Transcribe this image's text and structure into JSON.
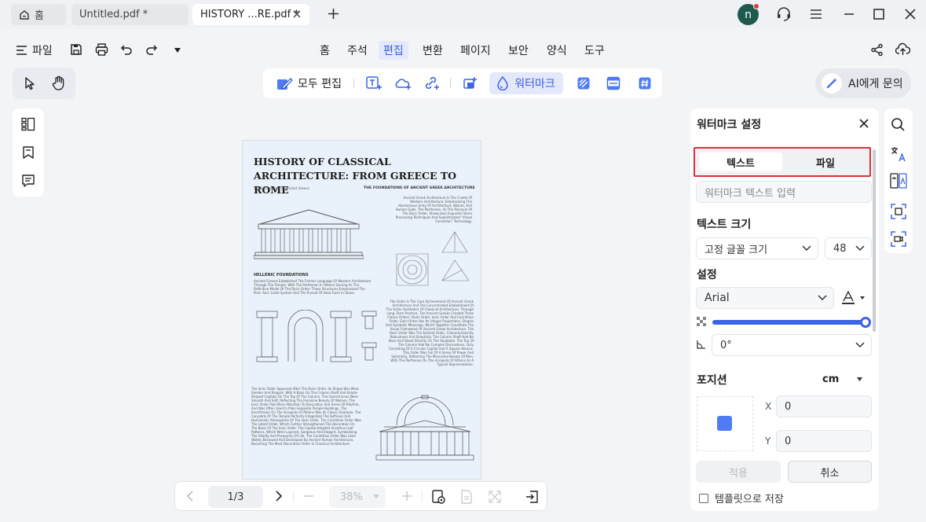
{
  "titlebar": {
    "home_label": "홈",
    "tabs": [
      {
        "label": "Untitled.pdf *"
      },
      {
        "label": "HISTORY ...RE.pdf *"
      }
    ],
    "avatar_letter": "n"
  },
  "menubar": {
    "file_label": "파일",
    "items": [
      {
        "label": "홈"
      },
      {
        "label": "주석"
      },
      {
        "label": "편집"
      },
      {
        "label": "변환"
      },
      {
        "label": "페이지"
      },
      {
        "label": "보안"
      },
      {
        "label": "양식"
      },
      {
        "label": "도구"
      }
    ],
    "active": "편집"
  },
  "edit_toolbar": {
    "edit_all_label": "모두 편집",
    "watermark_label": "워터마크"
  },
  "ai_button": {
    "label": "AI에게 문의"
  },
  "document": {
    "title": "HISTORY OF CLASSICAL  ARCHITECTURE: FROM GREECE TO ROME",
    "subtitle": "The Cornerstone Of Ancient Greece",
    "heading_right": "THE FOUNDATIONS OF ANCIENT GREEK ARCHITECTURE",
    "heading_left": "HELLENIC FOUNDATIONS",
    "para1": "Ancient Greek Architecture Is The Cradle Of Western Architecture, Emphasizing The Harmonious Unity Of Architecture, Nature, And Human Gods. The Parthenon, As The Pinnacle Of The Doric Order, Showcases Exquisite Stone Processing Techniques And Sophisticated \"Visual Correction\" Technology.",
    "para2": "Ancient Greece Established The Former Language Of Western Architecture Through The Temple. With The Parthenon In Athens Serving As The Definitive Model Of The Doric Order. These Structures Emphasized The Post- And -Lintel System And The Pursuit Of Ideal Form In Stone.",
    "para3": "The Order Is The Core Achievement Of Ancient Greek Architecture And The Concentrated Embodiment Of The Order Aesthetics Of Classical Architecture. Through Long -Term Practice, The Ancient Greeks Created Three Classic Orders: Doric Order, Ionic Order And Corinthian Order. Each Order Has Its Unique Proportions, Shapes And Symbolic Meanings, Which Together Constitute The Visual Framework Of Ancient Greek Architecture. The Doric Order Was The Earliest Order, Characterized By Robustness And Simplicity. The Column Shaft Had No Base And Stood Directly On The Stylobate. The Top Of The Column Had No Complex Decorations, Only Consisting Of A Circular Capital And A Square Abacus. This Order Was Full Of A Sense Of Power And Solemnity, Reflecting The Masculine Beauty Of Men, With The Parthenon On The Acropolis Of Athens As A Typical Representative.",
    "para4": "The Ionic Order Appeared After The Doric Order. Its Shape Was More Slender And Elegant, With A Base On The Column Shaft And Volute-Shaped Capitals On The Top Of The Column. The Overall Lines Were Smooth And Soft, Reflecting The Feminine Beauty Of Women. The Ionic Order Paid More Attention To Decoration And Sense Of Rhythm, And Was Often Used In Plain Exquisite Temple Buildings. The Erechtheion On The Acropolis Of Athens Was Its Classic Example. The Caryatids Of The Temple Perfectly Integrated The Softness And Humanistic Atmosphere Of The Ionic Order. The Corinthian Order Was The Latest Order, Which Further Strengthened The Decoration On The Basis Of The Ionic Order. The Capital Adopted Acanthus Leaf Patterns, Which Were Layered, Gorgeous And Elegant, Symbolizing The Vitality And Prosperity Of Life. The Corinthian Order Was Later Widely Borrowed And Developed By Ancient Roman Architecture, Becoming The Most Decorative Order In Classical Architecture."
  },
  "bottombar": {
    "page_indicator": "1/3",
    "zoom": "38%"
  },
  "panel": {
    "title": "워터마크 설정",
    "tab_text": "텍스트",
    "tab_file": "파일",
    "text_placeholder": "워터마크 텍스트 입력",
    "text_size_heading": "텍스트 크기",
    "size_mode": "고정 글꼴 크기",
    "font_size": "48",
    "settings_heading": "설정",
    "font": "Arial",
    "opacity": 1.0,
    "rotation": "0°",
    "position_heading": "포지션",
    "unit": "cm",
    "x_label": "X",
    "x_value": "0",
    "y_label": "Y",
    "y_value": "0",
    "apply_label": "적용",
    "cancel_label": "취소",
    "save_template_label": "템플릿으로 저장"
  },
  "colors": {
    "accent": "#3d63e6",
    "highlight": "#d9313b"
  }
}
